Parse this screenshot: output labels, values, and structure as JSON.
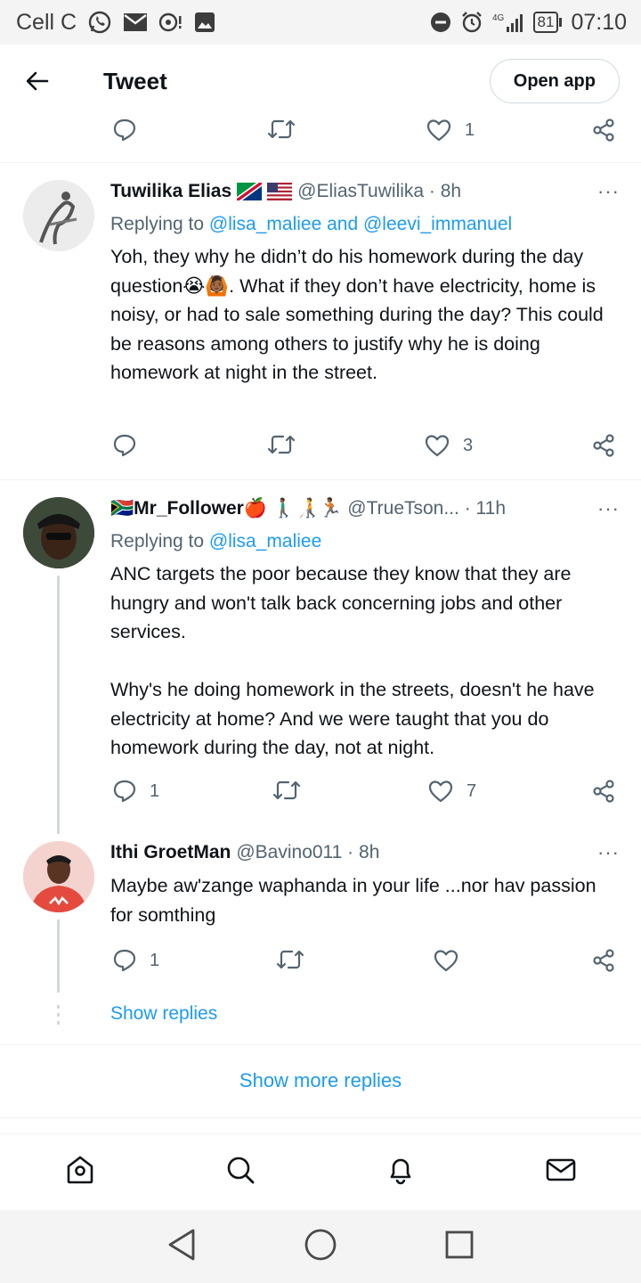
{
  "status_bar": {
    "carrier": "Cell C",
    "network": "4G",
    "battery": "81",
    "time": "07:10"
  },
  "header": {
    "title": "Tweet",
    "open_app_label": "Open app"
  },
  "top_actions": {
    "like_count": "1"
  },
  "tweets": [
    {
      "name": "Tuwilika Elias",
      "handle": "@EliasTuwilika · 8h",
      "replying_prefix": "Replying to ",
      "replying_to": "@lisa_maliee and @leevi_immanuel",
      "body": "Yoh, they why he didn’t do his homework during the day question😭🙆🏾. What if they don’t have electricity, home is noisy, or had to sale something during the day? This could be reasons among others to justify why he is doing homework at night in the street.",
      "reply_count": "",
      "like_count": "3"
    },
    {
      "name_prefix": "🇿🇦 ",
      "name": "Mr_Follower",
      "name_suffix": " 🍎 🚶🏾‍♂️🧑‍🦯🏃🏾",
      "handle": "@TrueTson... · 11h",
      "replying_prefix": "Replying to ",
      "replying_to": "@lisa_maliee",
      "body": "ANC targets the poor because they know that they are hungry and won't talk back concerning jobs and other services.\n\nWhy's he doing homework in the streets, doesn't he have electricity at home? And we were taught that you do homework during the day, not at night.",
      "reply_count": "1",
      "like_count": "7"
    },
    {
      "name": "Ithi GroetMan",
      "handle": "@Bavino011 · 8h",
      "body": "Maybe aw'zange waphanda in your life ...nor hav passion for somthing",
      "reply_count": "1",
      "like_count": ""
    }
  ],
  "more_icon": "···",
  "show_replies_label": "Show replies",
  "show_more_replies_label": "Show more replies",
  "bottom_nav": [
    "home-icon",
    "search-icon",
    "notifications-bell-icon",
    "messages-envelope-icon"
  ],
  "android_nav": [
    "back-triangle-icon",
    "home-circle-icon",
    "recents-square-icon"
  ],
  "colors": {
    "link": "#1d9bf0",
    "secondary_text": "#536471",
    "divider": "#eff3f4"
  }
}
